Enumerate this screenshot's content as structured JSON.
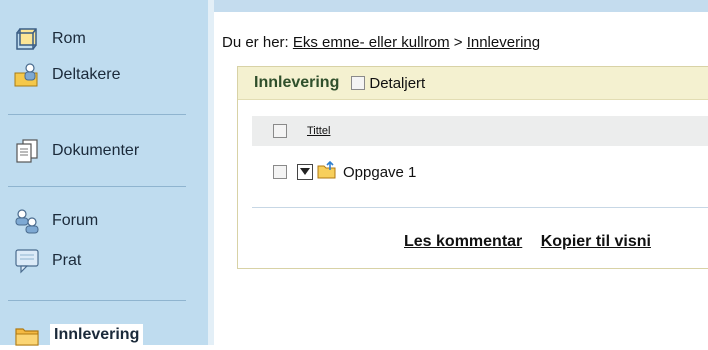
{
  "sidebar": {
    "items": [
      {
        "label": "Rom",
        "icon": "cube-icon"
      },
      {
        "label": "Deltakere",
        "icon": "participants-icon"
      },
      {
        "label": "Dokumenter",
        "icon": "documents-icon"
      },
      {
        "label": "Forum",
        "icon": "forum-icon"
      },
      {
        "label": "Prat",
        "icon": "chat-icon"
      },
      {
        "label": "Innlevering",
        "icon": "folder-icon"
      }
    ]
  },
  "breadcrumb": {
    "prefix": "Du er her:",
    "parent": "Eks emne- eller kullrom",
    "separator": ">",
    "current": "Innlevering"
  },
  "panel": {
    "title": "Innlevering",
    "detail_label": "Detaljert",
    "column_title": "Tittel",
    "rows": [
      {
        "name": "Oppgave 1"
      }
    ],
    "actions": [
      "Les kommentar",
      "Kopier til visni"
    ]
  },
  "colors": {
    "sidebar_bg": "#bfdcef",
    "panel_header_bg": "#f4f1d0",
    "panel_title": "#2f4f2b"
  }
}
